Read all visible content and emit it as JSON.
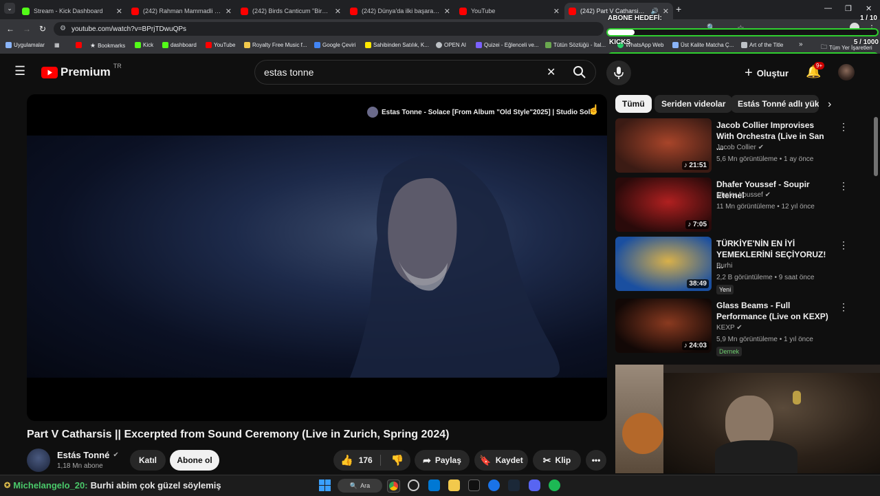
{
  "browser": {
    "tabs": [
      {
        "title": "Stream - Kick Dashboard",
        "color": "#53fc18"
      },
      {
        "title": "(242) Rahman Mammadli & Tur",
        "color": "#ff0000"
      },
      {
        "title": "(242) Birds Canticum \"Birds Re",
        "color": "#ff0000"
      },
      {
        "title": "(242) Dünya'da ilki başaranlar...",
        "color": "#ff0000"
      },
      {
        "title": "YouTube",
        "color": "#ff0000"
      },
      {
        "title": "(242) Part V Catharsis || Exce",
        "color": "#ff0000"
      }
    ],
    "url": "youtube.com/watch?v=BPrjTDwuQPs",
    "bookmarks": [
      {
        "label": "Uygulamalar",
        "color": "#8ab4f8"
      },
      {
        "label": "Bookmarks",
        "color": "#bdc1c6"
      },
      {
        "label": "Kick",
        "color": "#53fc18"
      },
      {
        "label": "dashboard",
        "color": "#53fc18"
      },
      {
        "label": "YouTube",
        "color": "#ff0000"
      },
      {
        "label": "Royalty Free Music f...",
        "color": "#f2c94c"
      },
      {
        "label": "Google Çeviri",
        "color": "#4285f4"
      },
      {
        "label": "Sahibinden Satılık, K...",
        "color": "#ffe800"
      },
      {
        "label": "OPEN AI",
        "color": "#bdc1c6"
      },
      {
        "label": "Quizei - Eğlenceli ve...",
        "color": "#7b61ff"
      },
      {
        "label": "Tütün Sözlüğü - İtal...",
        "color": "#6aa84f"
      },
      {
        "label": "WhatsApp Web",
        "color": "#25d366"
      },
      {
        "label": "Üst Kalite Matcha Ç...",
        "color": "#8ab4f8"
      },
      {
        "label": "Art of the Title",
        "color": "#bdc1c6"
      },
      {
        "label": "Tüm Yer İşaretleri",
        "color": "#bdc1c6"
      }
    ]
  },
  "overlay": {
    "goal_title": "ABONE HEDEFİ:",
    "goal_count": "1 / 10",
    "goal_progress": 0.1,
    "kicks_title": "KICKS",
    "kicks_count": "5 / 1000",
    "kicks_progress": 0.005
  },
  "youtube": {
    "brand": "Premium",
    "region": "TR",
    "search_query": "estas tonne",
    "create_label": "Oluştur",
    "notif_count": "9+",
    "overlay_video_title": "Estas Tonne - Solace [From Album \"Old Style\"2025] | Studio Sol...",
    "video_title": "Part V Catharsis || Excerpted from Sound Ceremony (Live in Zurich, Spring 2024)",
    "channel_name": "Estás Tonné",
    "subscribers": "1,18 Mn abone",
    "join_label": "Katıl",
    "subscribe_label": "Abone ol",
    "likes": "176",
    "share_label": "Paylaş",
    "save_label": "Kaydet",
    "clip_label": "Klip",
    "chips": [
      "Tümü",
      "Seriden videolar",
      "Estás Tonné adlı yükle"
    ],
    "related": [
      {
        "title": "Jacob Collier Improvises With Orchestra (Live in San ...",
        "channel": "Jacob Collier",
        "meta": "5,6 Mn görüntüleme • 1 ay önce",
        "duration": "21:51",
        "badge": "",
        "colors": [
          "#3b1b14",
          "#a8452a"
        ]
      },
      {
        "title": "Dhafer Youssef - Soupir Eternel",
        "channel": "Dhafer Youssef",
        "meta": "11 Mn görüntüleme • 12 yıl önce",
        "duration": "7:05",
        "badge": "",
        "colors": [
          "#2a0a0a",
          "#b02020"
        ]
      },
      {
        "title": "TÜRKİYE'NİN EN İYİ YEMEKLERİNİ SEÇİYORUZ! ...",
        "channel": "Burhi",
        "meta": "2,2 B görüntüleme • 9 saat önce",
        "duration": "38:49",
        "badge": "Yeni",
        "colors": [
          "#1a4fa0",
          "#d8b04a"
        ]
      },
      {
        "title": "Glass Beams - Full Performance (Live on KEXP)",
        "channel": "KEXP",
        "meta": "5,9 Mn görüntüleme • 1 yıl önce",
        "duration": "24:03",
        "badge": "Dernek",
        "colors": [
          "#120806",
          "#8a3a20"
        ]
      }
    ]
  },
  "chat": {
    "username": "Michelangelo_20:",
    "message": "Burhi abim çok güzel söylemiş"
  },
  "taskbar": {
    "search_label": "Ara"
  }
}
